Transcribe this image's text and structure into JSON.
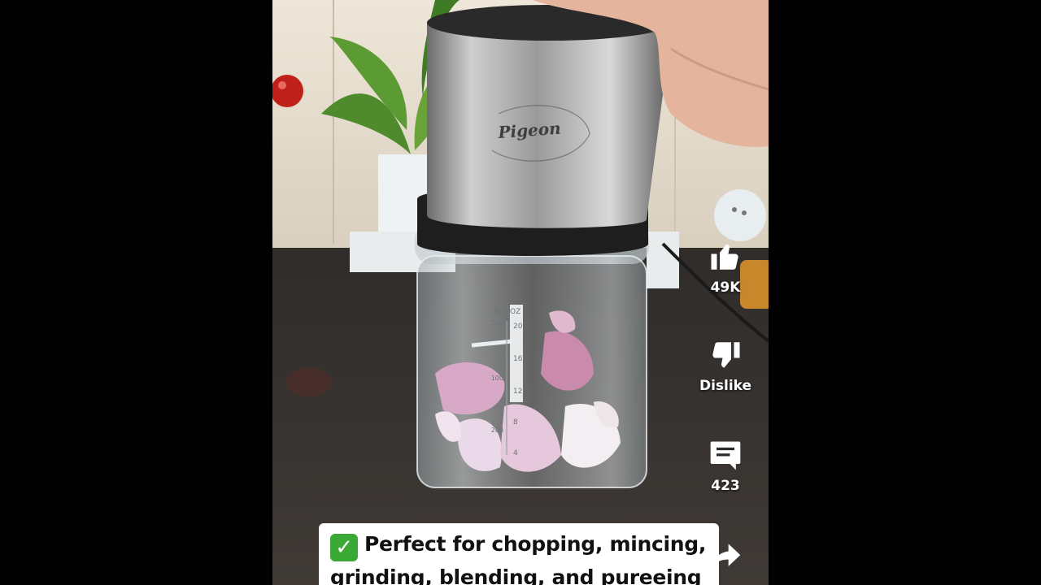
{
  "video": {
    "brand_text": "Pigeon",
    "scale_unit_oz": "OZ",
    "scale_unit_ml": "ML",
    "scale_oz": [
      "20",
      "16",
      "12",
      "8",
      "4"
    ],
    "scale_ml": [
      "200",
      "100",
      "200"
    ]
  },
  "actions": {
    "like_count": "49K",
    "dislike_label": "Dislike",
    "comment_count": "423"
  },
  "caption": {
    "line1": "Perfect for chopping, mincing,",
    "line2": "grinding, blending, and pureeing",
    "check_icon": "white-check-mark-emoji"
  }
}
